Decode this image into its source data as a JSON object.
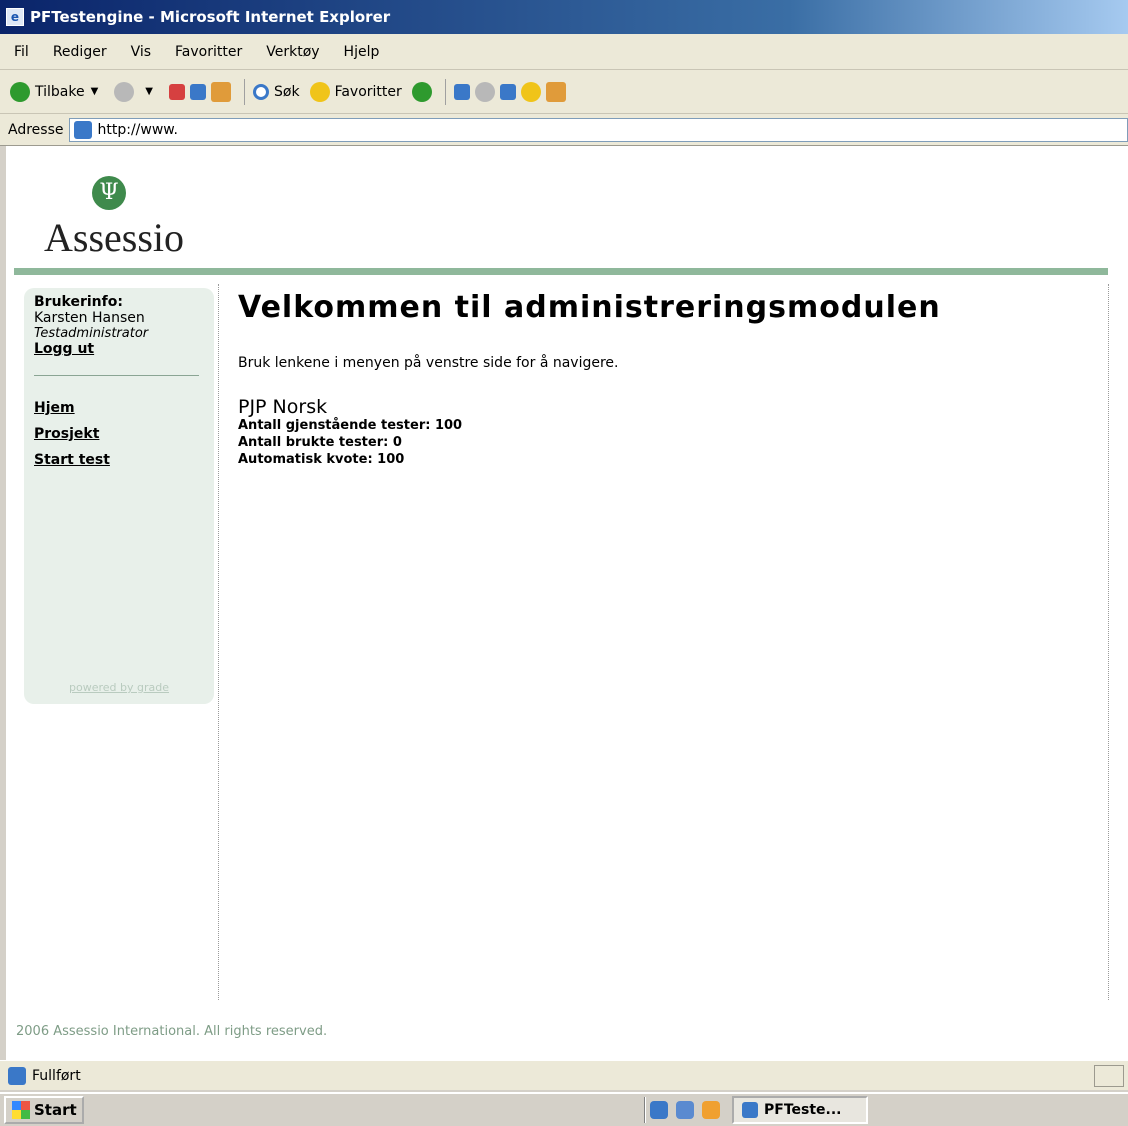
{
  "window": {
    "title": "PFTestengine - Microsoft Internet Explorer"
  },
  "menubar": [
    "Fil",
    "Rediger",
    "Vis",
    "Favoritter",
    "Verktøy",
    "Hjelp"
  ],
  "toolbar": {
    "back_label": "Tilbake",
    "search_label": "Søk",
    "favorites_label": "Favoritter"
  },
  "address": {
    "label": "Adresse",
    "url": "http://www."
  },
  "logo": {
    "text": "Assessio",
    "mark": "Ψ"
  },
  "sidebar": {
    "userinfo_label": "Brukerinfo:",
    "user_name": "Karsten Hansen",
    "user_role": "Testadministrator",
    "logout_label": "Logg ut",
    "nav": [
      {
        "label": "Hjem"
      },
      {
        "label": "Prosjekt"
      },
      {
        "label": "Start test"
      }
    ],
    "powered_by": "powered by grade"
  },
  "main": {
    "heading": "Velkommen til administreringsmodulen",
    "intro": "Bruk lenkene i menyen på venstre side for å navigere.",
    "project_name": "PJP Norsk",
    "stats": [
      "Antall gjenstående tester:  100",
      "Antall brukte tester:  0",
      "Automatisk kvote:  100"
    ]
  },
  "footer": {
    "copyright": "2006 Assessio International. All rights reserved."
  },
  "statusbar": {
    "status": "Fullført"
  },
  "taskbar": {
    "start_label": "Start",
    "task_label": "PFTeste..."
  },
  "colors": {
    "accent_green": "#8fb89b",
    "sidebar_bg": "#e8f0ea",
    "logo_green": "#3f8a4c"
  }
}
